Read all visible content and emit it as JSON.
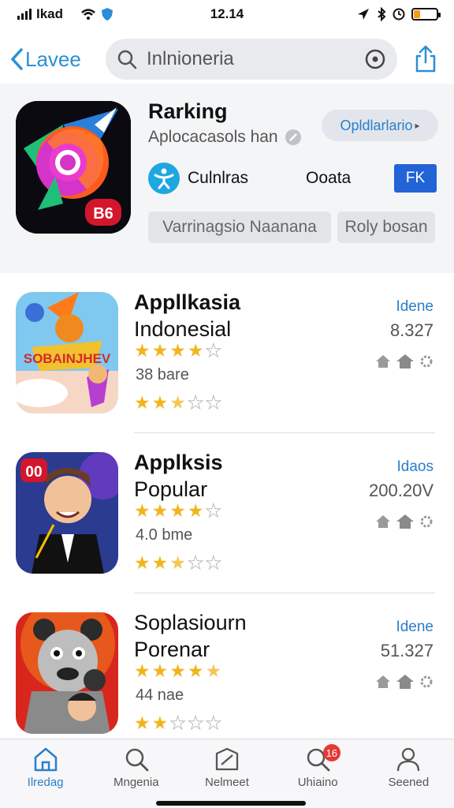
{
  "status_bar": {
    "carrier": "Ikad",
    "time": "12.14",
    "battery_color": "#f39c12"
  },
  "nav": {
    "back_label": "Lavee",
    "search_placeholder": "Inlnioneria"
  },
  "header": {
    "title": "Rarking",
    "subtitle": "Aplocacasols han",
    "pill_button": "Opldlarlario",
    "icon_badge": "B6",
    "category_label": "Culnlras",
    "category_value": "Ooata",
    "badge_button": "FK",
    "chip_1": "Varrinagsio Naanana",
    "chip_2": "Roly bosan"
  },
  "apps": [
    {
      "title_line1": "Appllkasia",
      "title_line2": "Indonesial",
      "icon_text": "SOBAINJHEV",
      "rating_stars": 4.5,
      "count": "38 bare",
      "link": "Idene",
      "number": "8.327",
      "sub_rating": 2.5
    },
    {
      "title_line1": "Applksis",
      "title_line2": "Popular",
      "icon_text": "00",
      "rating_stars": 4.5,
      "count": "4.0 bme",
      "link": "Idaos",
      "number": "200.20V",
      "sub_rating": 2.5
    },
    {
      "title_line1": "Soplasiourn",
      "title_line2": "Porenar",
      "icon_text": "",
      "rating_stars": 4.5,
      "count": "44 nae",
      "link": "Idene",
      "number": "51.327",
      "sub_rating": 2
    }
  ],
  "tabs": [
    {
      "label": "Ilredag",
      "icon": "home-icon",
      "active": true
    },
    {
      "label": "Mngenia",
      "icon": "search-icon",
      "active": false
    },
    {
      "label": "Nelmeet",
      "icon": "box-icon",
      "active": false
    },
    {
      "label": "Uhiaino",
      "icon": "search-icon",
      "active": false,
      "badge": "16"
    },
    {
      "label": "Seened",
      "icon": "person-icon",
      "active": false
    }
  ],
  "colors": {
    "accent": "#2a7fc9",
    "star": "#f2b41c",
    "badge_blue": "#2263d6",
    "notification": "#e53935"
  }
}
